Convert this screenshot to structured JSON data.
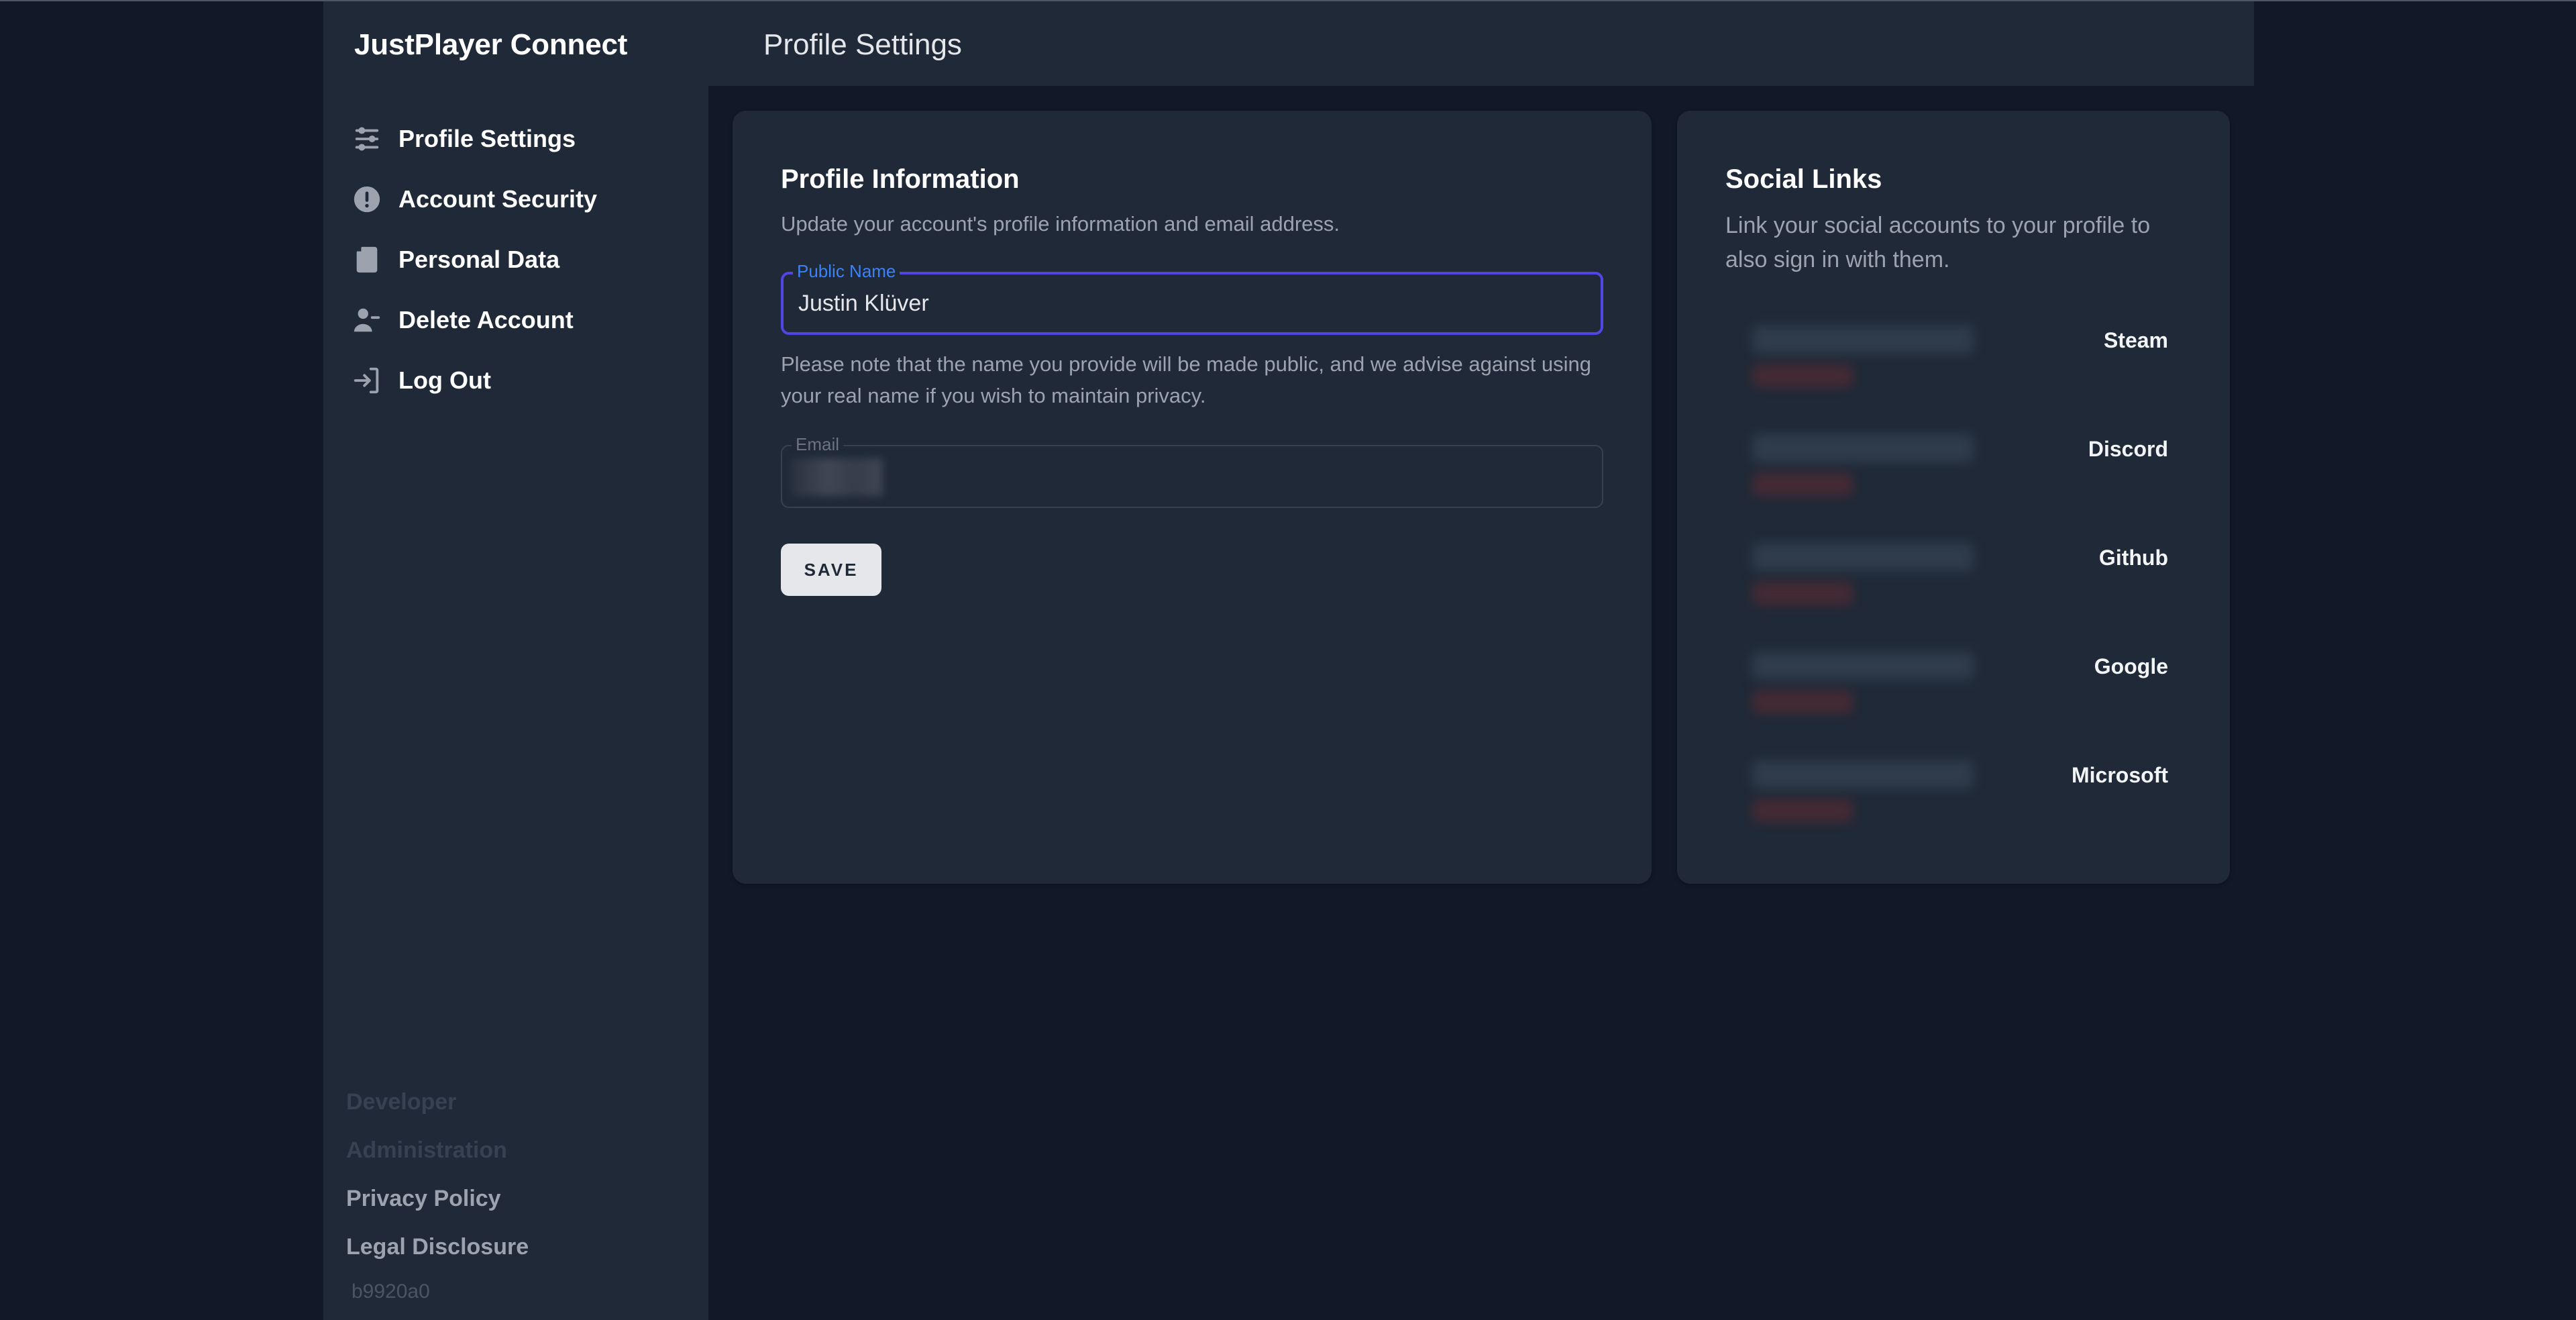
{
  "app": {
    "title": "JustPlayer Connect"
  },
  "header": {
    "title": "Profile Settings"
  },
  "sidebar": {
    "items": [
      {
        "label": "Profile Settings",
        "icon": "sliders-icon"
      },
      {
        "label": "Account Security",
        "icon": "exclamation-circle-icon"
      },
      {
        "label": "Personal Data",
        "icon": "document-icon"
      },
      {
        "label": "Delete Account",
        "icon": "user-minus-icon"
      },
      {
        "label": "Log Out",
        "icon": "logout-icon"
      }
    ],
    "footer": [
      {
        "label": "Developer",
        "state": "disabled"
      },
      {
        "label": "Administration",
        "state": "disabled"
      },
      {
        "label": "Privacy Policy",
        "state": "enabled"
      },
      {
        "label": "Legal Disclosure",
        "state": "enabled"
      }
    ],
    "version": "b9920a0"
  },
  "profile": {
    "title": "Profile Information",
    "subtitle": "Update your account's profile information and email address.",
    "public_name": {
      "label": "Public Name",
      "value": "Justin Klüver"
    },
    "help": "Please note that the name you provide will be made public, and we advise against using your real name if you wish to maintain privacy.",
    "email": {
      "label": "Email",
      "value_obscured": true
    },
    "save_label": "SAVE"
  },
  "social": {
    "title": "Social Links",
    "subtitle": "Link your social accounts to your profile to also sign in with them.",
    "providers": [
      {
        "name": "Steam"
      },
      {
        "name": "Discord"
      },
      {
        "name": "Github"
      },
      {
        "name": "Google"
      },
      {
        "name": "Microsoft"
      }
    ]
  },
  "colors": {
    "background": "#111827",
    "surface": "#1f2937",
    "focus_border": "#4f46e5",
    "focus_label": "#3b82f6",
    "text_primary": "#ffffff",
    "text_muted": "#9ca3af",
    "button_bg": "#e5e7eb"
  }
}
